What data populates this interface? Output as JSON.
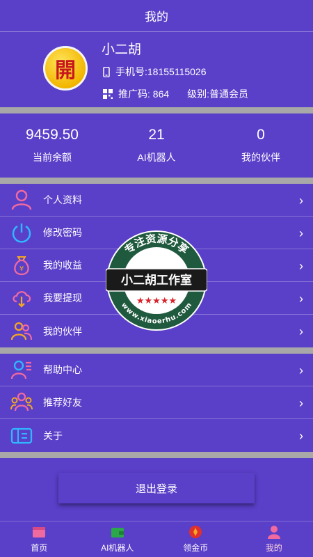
{
  "header": {
    "title": "我的"
  },
  "profile": {
    "avatar_char": "開",
    "name": "小二胡",
    "phone_label": "手机号:",
    "phone": "18155115026",
    "promo_label": "推广码:",
    "promo_code": "864",
    "level_label": "级别:",
    "level": "普通会员"
  },
  "stats": [
    {
      "value": "9459.50",
      "label": "当前余额"
    },
    {
      "value": "21",
      "label": "AI机器人"
    },
    {
      "value": "0",
      "label": "我的伙伴"
    }
  ],
  "menu1": [
    {
      "label": "个人资料",
      "icon": "user-icon"
    },
    {
      "label": "修改密码",
      "icon": "power-icon"
    },
    {
      "label": "我的收益",
      "icon": "money-bag-icon"
    },
    {
      "label": "我要提现",
      "icon": "cloud-download-icon"
    },
    {
      "label": "我的伙伴",
      "icon": "partners-icon"
    }
  ],
  "menu2": [
    {
      "label": "帮助中心",
      "icon": "help-icon"
    },
    {
      "label": "推荐好友",
      "icon": "recommend-icon"
    },
    {
      "label": "关于",
      "icon": "about-icon"
    }
  ],
  "logout_label": "退出登录",
  "tabs": [
    {
      "label": "首页",
      "icon": "home-icon"
    },
    {
      "label": "AI机器人",
      "icon": "wallet-icon"
    },
    {
      "label": "领金币",
      "icon": "coin-icon"
    },
    {
      "label": "我的",
      "icon": "profile-icon",
      "active": true
    }
  ],
  "watermark": {
    "top_text": "专注资源分享",
    "main_text": "小二胡工作室",
    "url_text": "www.xiaoerhu.com"
  },
  "colors": {
    "background": "#5a3fc8",
    "separator": "#a8a8a8",
    "avatar_gold": "#f2b600",
    "avatar_char": "#c8161d",
    "icon_pink": "#f06aa0",
    "icon_orange": "#f5a623",
    "icon_blue": "#2fb8ff",
    "active_tab": "#ffd7e0"
  }
}
